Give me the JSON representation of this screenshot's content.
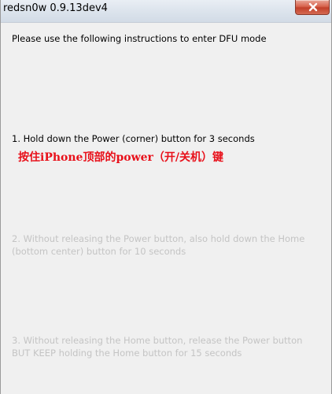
{
  "window": {
    "title": "redsn0w 0.9.13dev4"
  },
  "instructions": {
    "intro": "Please use the following instructions to enter DFU mode",
    "step1": "1. Hold down the Power (corner) button for 3 seconds",
    "step1_annotation": "按住iPhone顶部的power（开/关机）键",
    "step2_line1": "2. Without releasing the Power button, also hold down the Home",
    "step2_line2": "(bottom center) button for 10 seconds",
    "step3_line1": "3. Without releasing the Home button, release the Power button",
    "step3_line2": "BUT KEEP holding the Home button for 15 seconds"
  },
  "colors": {
    "active_text": "#000000",
    "inactive_text": "#c4c4c4",
    "annotation": "#e8101a",
    "close_button": "#c94a34"
  },
  "icons": {
    "close": "close-icon"
  }
}
